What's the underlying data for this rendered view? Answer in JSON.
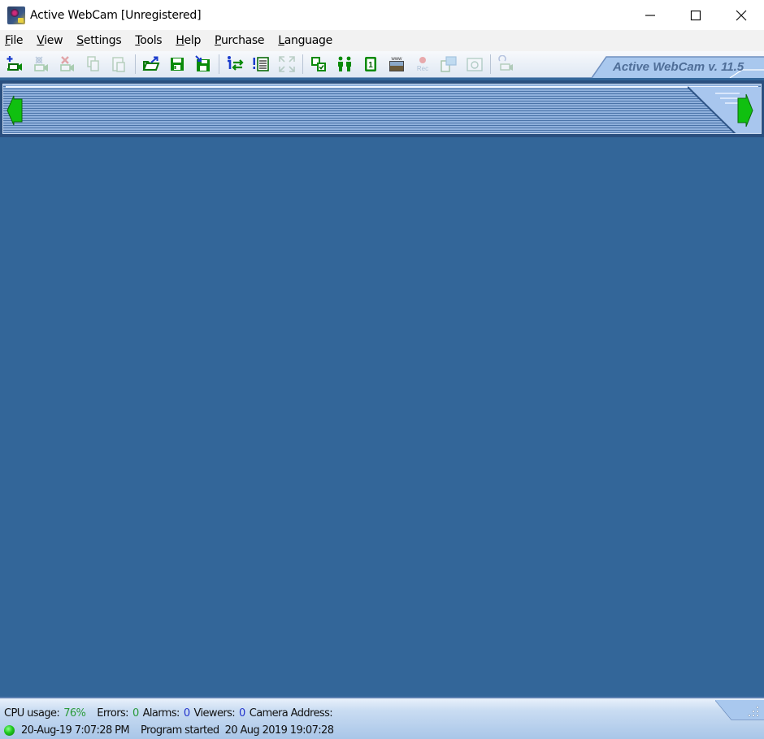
{
  "window": {
    "title": "Active WebCam [Unregistered]",
    "controls": {
      "minimize": "minimize",
      "maximize": "maximize",
      "close": "close"
    }
  },
  "menu": {
    "items": [
      {
        "label": "File",
        "accel": "F",
        "rest": "ile"
      },
      {
        "label": "View",
        "accel": "V",
        "rest": "iew"
      },
      {
        "label": "Settings",
        "accel": "S",
        "rest": "ettings"
      },
      {
        "label": "Tools",
        "accel": "T",
        "rest": "ools"
      },
      {
        "label": "Help",
        "accel": "H",
        "rest": "elp"
      },
      {
        "label": "Purchase",
        "accel": "P",
        "rest": "urchase"
      },
      {
        "label": "Language",
        "accel": "L",
        "rest": "anguage"
      }
    ]
  },
  "toolbar": {
    "buttons": [
      {
        "icon": "add-camera-icon",
        "enabled": true
      },
      {
        "icon": "camera-properties-icon",
        "enabled": false
      },
      {
        "icon": "delete-camera-icon",
        "enabled": false
      },
      {
        "icon": "copy-icon",
        "enabled": false
      },
      {
        "icon": "paste-icon",
        "enabled": false
      },
      {
        "icon": "open-icon",
        "enabled": true
      },
      {
        "icon": "save-icon",
        "enabled": true
      },
      {
        "icon": "save-as-icon",
        "enabled": true
      },
      {
        "icon": "information-icon",
        "enabled": true
      },
      {
        "icon": "event-log-icon",
        "enabled": true
      },
      {
        "icon": "full-screen-icon",
        "enabled": false
      },
      {
        "icon": "layout-icon",
        "enabled": true
      },
      {
        "icon": "users-icon",
        "enabled": true
      },
      {
        "icon": "schedule-icon",
        "enabled": true
      },
      {
        "icon": "web-publish-icon",
        "enabled": true
      },
      {
        "icon": "record-icon",
        "enabled": false,
        "label": "Rec"
      },
      {
        "icon": "capture-image-icon",
        "enabled": false
      },
      {
        "icon": "snapshot-icon",
        "enabled": false
      },
      {
        "icon": "network-camera-icon",
        "enabled": false
      }
    ],
    "version_label": "Active WebCam v. 11.5"
  },
  "status": {
    "cpu_label": "CPU usage:",
    "cpu_value": "76%",
    "errors_label": "Errors:",
    "errors_value": "0",
    "alarms_label": "Alarms:",
    "alarms_value": "0",
    "viewers_label": "Viewers:",
    "viewers_value": "0",
    "camera_address_label": "Camera Address:",
    "camera_address_value": "",
    "datetime": "20-Aug-19 7:07:28 PM",
    "message": "Program started  20 Aug 2019 19:07:28"
  },
  "colors": {
    "background": "#336699",
    "status_green": "#2a9a3a",
    "status_blue": "#2233cc",
    "arrow_green": "#10c010"
  }
}
